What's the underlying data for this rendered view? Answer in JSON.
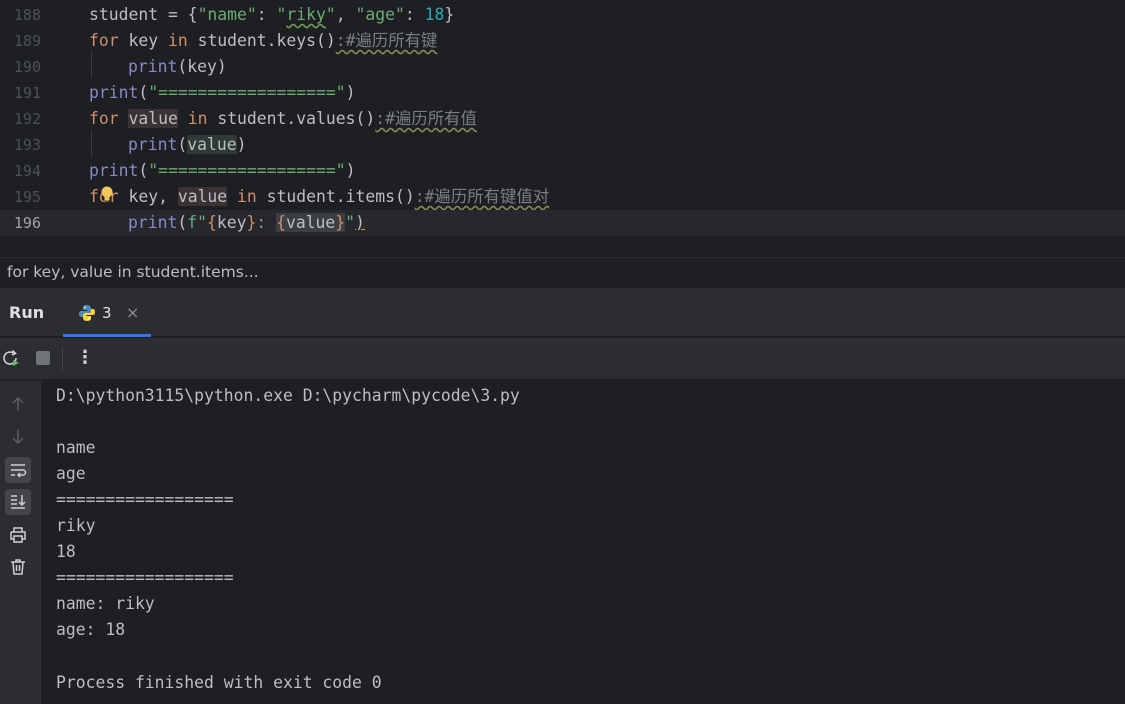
{
  "editor": {
    "line_numbers": [
      "188",
      "189",
      "190",
      "191",
      "192",
      "193",
      "194",
      "195",
      "196"
    ],
    "code": {
      "l188": {
        "var": "student",
        "eq": " = {",
        "k1": "\"name\"",
        "c1": ": ",
        "v1a": "\"",
        "v1b": "riky",
        "v1c": "\"",
        "c2": ", ",
        "k2": "\"age\"",
        "c3": ": ",
        "v2": "18",
        "end": "}"
      },
      "l189": {
        "kw1": "for",
        "t1": " key ",
        "kw2": "in",
        "t2": " student.keys()",
        "c": ":#遍历所有键"
      },
      "l190": {
        "fn": "print",
        "t": "(key)"
      },
      "l191": {
        "fn": "print",
        "p1": "(",
        "s": "\"==================\"",
        "p2": ")"
      },
      "l192": {
        "kw1": "for",
        "sp": " ",
        "var": "value",
        "sp2": " ",
        "kw2": "in",
        "t2": " student.values()",
        "c": ":#遍历所有值"
      },
      "l193": {
        "fn": "print",
        "p1": "(",
        "var": "value",
        "p2": ")"
      },
      "l194": {
        "fn": "print",
        "p1": "(",
        "s": "\"==================\"",
        "p2": ")"
      },
      "l195": {
        "kw1": "for",
        "t1": " key, ",
        "var": "value",
        "sp2": " ",
        "kw2": "in",
        "t2": " student.items()",
        "c": ":#遍历所有键值对"
      },
      "l196": {
        "fn": "print",
        "p1": "(",
        "s1": "f\"",
        "b1": "{",
        "v1": "key",
        "b2": "}",
        "s2": ": ",
        "b3": "{",
        "v2": "value",
        "b4": "}",
        "s3": "\"",
        "p2": ")"
      }
    }
  },
  "breadcrumb": "for key, value in student.items...",
  "run_panel": {
    "title": "Run",
    "tab_label": "3",
    "tab_close": "×",
    "tab_icon": "python-icon"
  },
  "toolbar": {
    "more": "⋮"
  },
  "console": {
    "lines": [
      "D:\\python3115\\python.exe D:\\pycharm\\pycode\\3.py",
      "",
      "name",
      "age",
      "==================",
      "riky",
      "18",
      "==================",
      "name: riky",
      "age: 18",
      "",
      "Process finished with exit code 0"
    ]
  },
  "colors": {
    "accent": "#3574f0",
    "keyword": "#cf8e6d",
    "string": "#6aab73",
    "number": "#2aacb8",
    "builtin": "#8888c6"
  }
}
